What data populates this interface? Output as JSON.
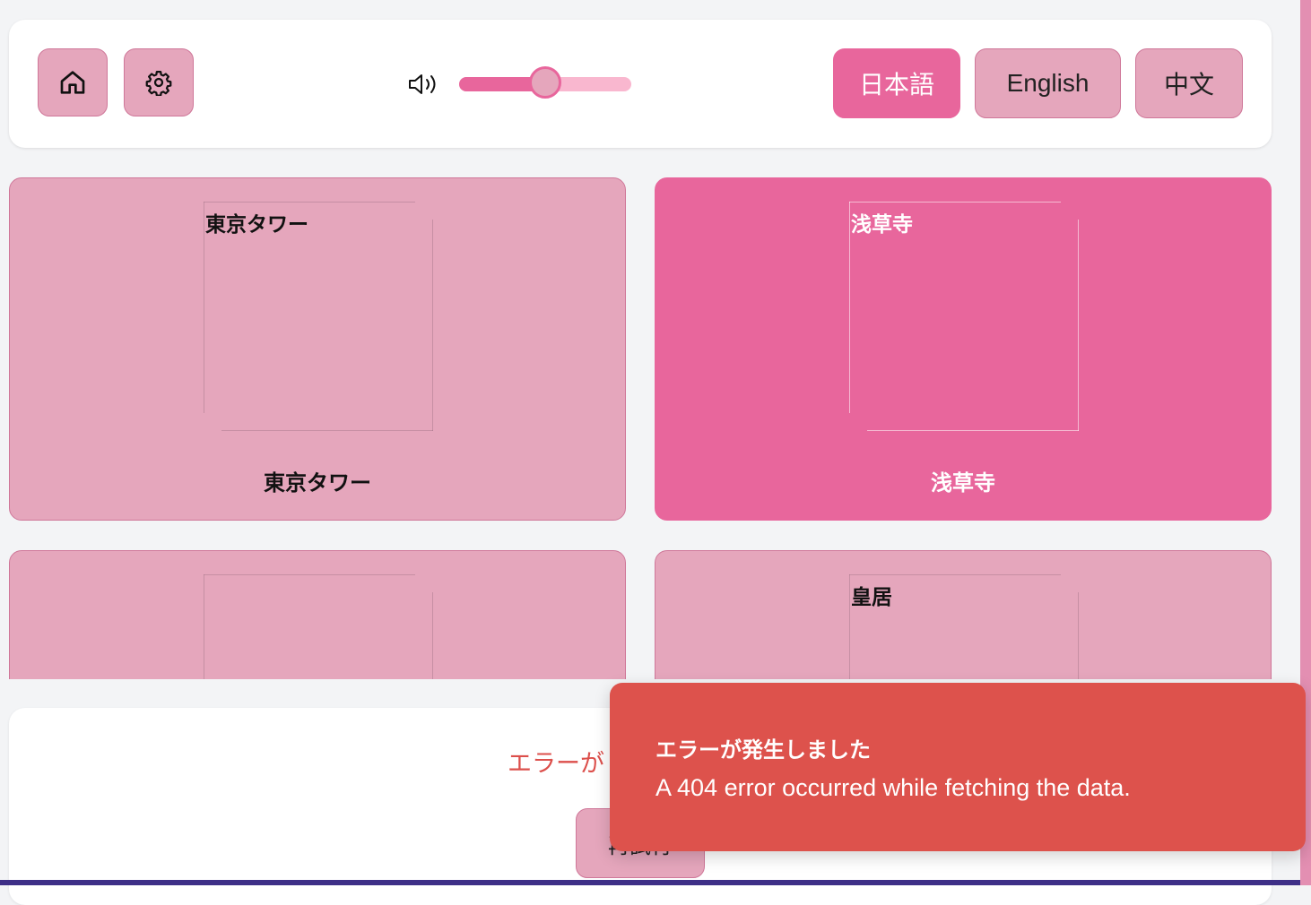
{
  "header": {
    "home_icon": "home-icon",
    "settings_icon": "gear-icon",
    "volume_icon": "speaker-volume-icon",
    "volume_level": 0.5,
    "languages": [
      {
        "label": "日本語",
        "active": true
      },
      {
        "label": "English",
        "active": false
      },
      {
        "label": "中文",
        "active": false
      }
    ]
  },
  "cards": [
    {
      "alt": "東京タワー",
      "label": "東京タワー",
      "selected": false
    },
    {
      "alt": "浅草寺",
      "label": "浅草寺",
      "selected": true
    },
    {
      "alt": "",
      "label": "",
      "selected": false
    },
    {
      "alt": "皇居",
      "label": "",
      "selected": false
    }
  ],
  "error_panel": {
    "title": "エラーが",
    "retry_label": "再試行"
  },
  "toast": {
    "title": "エラーが発生しました",
    "message": "A 404 error occurred while fetching the data."
  },
  "colors": {
    "accent": "#e8669c",
    "button_bg": "#e5a6bc",
    "error": "#dd524c"
  }
}
